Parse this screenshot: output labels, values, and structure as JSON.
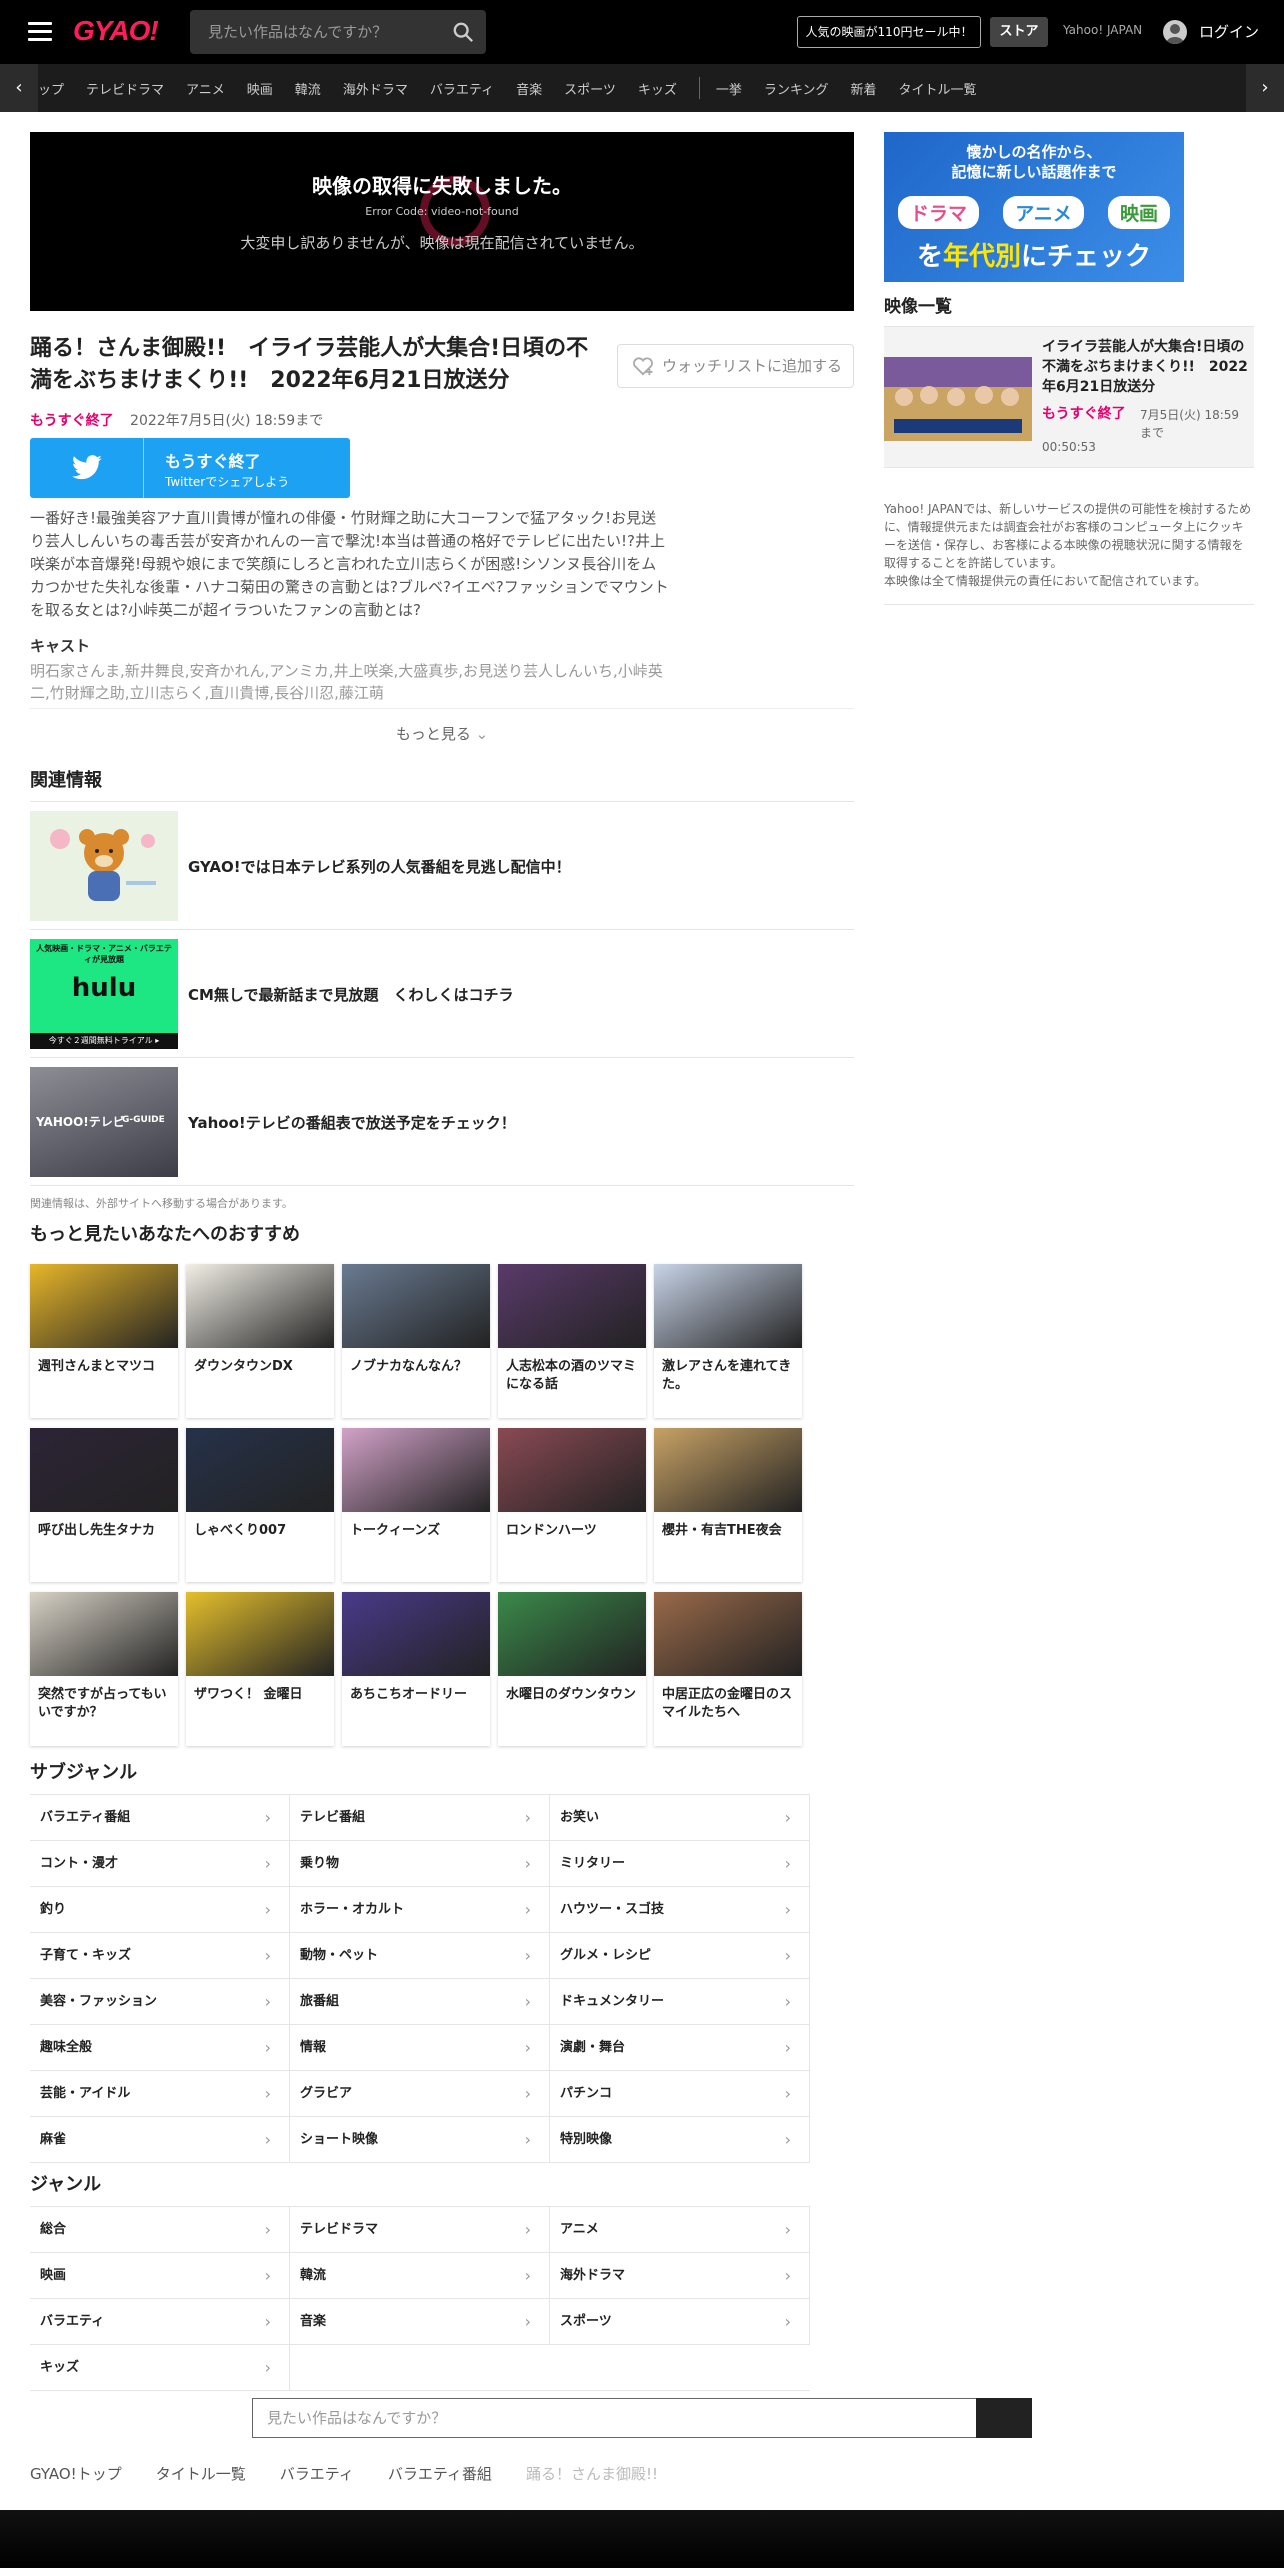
{
  "header": {
    "logo": "GYAO!",
    "search_placeholder": "見たい作品はなんですか？",
    "sale_banner": "人気の映画が110円セール中！",
    "store_button": "ストア",
    "yahoo_link": "Yahoo! JAPAN",
    "login": "ログイン"
  },
  "nav": {
    "items": [
      "ップ",
      "テレビドラマ",
      "アニメ",
      "映画",
      "韓流",
      "海外ドラマ",
      "バラエティ",
      "音楽",
      "スポーツ",
      "キッズ",
      "一挙",
      "ランキング",
      "新着",
      "タイトル一覧"
    ]
  },
  "player": {
    "error_title": "映像の取得に失敗しました。",
    "error_code": "Error Code: video-not-found",
    "error_message": "大変申し訳ありませんが、映像は現在配信されていません。"
  },
  "episode": {
    "title": "踊る！さんま御殿!!　イライラ芸能人が大集合!日頃の不満をぶちまけまくり!!　2022年6月21日放送分",
    "watchlist_button": "ウォッチリストに追加する",
    "ending_badge": "もうすぐ終了",
    "available_until": "2022年7月5日(火) 18:59まで",
    "twitter_line1": "もうすぐ終了",
    "twitter_line2": "Twitterでシェアしよう",
    "description": "一番好き!最強美容アナ直川貴博が憧れの俳優・竹財輝之助に大コーフンで猛アタック!お見送り芸人しんいちの毒舌芸が安斉かれんの一言で撃沈!本当は普通の格好でテレビに出たい!?井上咲楽が本音爆発!母親や娘にまで笑顔にしろと言われた立川志らくが困惑!シソンヌ長谷川をムカつかせた失礼な後輩・ハナコ菊田の驚きの言動とは?ブルベ?イエベ?ファッションでマウントを取る女とは?小峠英二が超イラついたファンの言動とは?",
    "cast_heading": "キャスト",
    "cast": "明石家さんま,新井舞良,安斉かれん,アンミカ,井上咲楽,大盛真歩,お見送り芸人しんいち,小峠英二,竹財輝之助,立川志らく,直川貴博,長谷川忍,藤江萌",
    "more_button": "もっと見る"
  },
  "related": {
    "heading": "関連情報",
    "items": [
      {
        "text": "GYAO!では日本テレビ系列の人気番組を見逃し配信中！"
      },
      {
        "text": "CM無しで最新話まで見放題　くわしくはコチラ",
        "thumb_top": "人気映画・ドラマ・アニメ・バラエティが見放題",
        "thumb_logo": "hulu",
        "thumb_bottom": "今すぐ２週間無料トライアル ▸"
      },
      {
        "text": "Yahoo!テレビの番組表で放送予定をチェック！",
        "thumb_logo": "YAHOO!テレビ",
        "thumb_sub": "G-GUIDE"
      }
    ],
    "note": "関連情報は、外部サイトへ移動する場合があります。"
  },
  "recommend": {
    "heading": "もっと見たいあなたへのおすすめ",
    "items": [
      {
        "title": "週刊さんまとマツコ",
        "color": "#e7b62a"
      },
      {
        "title": "ダウンタウンDX",
        "color": "#f2efe6"
      },
      {
        "title": "ノブナカなんなん？",
        "color": "#6a7b92"
      },
      {
        "title": "人志松本の酒のツマミになる話",
        "color": "#5a3a6a"
      },
      {
        "title": "激レアさんを連れてきた。",
        "color": "#c9d4e8"
      },
      {
        "title": "呼び出し先生タナカ",
        "color": "#2c2436"
      },
      {
        "title": "しゃべくり007",
        "color": "#26324a"
      },
      {
        "title": "トークィーンズ",
        "color": "#d2a2c8"
      },
      {
        "title": "ロンドンハーツ",
        "color": "#8a4a54"
      },
      {
        "title": "櫻井・有吉THE夜会",
        "color": "#c8a266"
      },
      {
        "title": "突然ですが占ってもいいですか？",
        "color": "#d8d2c6"
      },
      {
        "title": "ザワつく！ 金曜日",
        "color": "#e5c02c"
      },
      {
        "title": "あちこちオードリー",
        "color": "#4a3a8a"
      },
      {
        "title": "水曜日のダウンタウン",
        "color": "#3a8a4a"
      },
      {
        "title": "中居正広の金曜日のスマイルたちへ",
        "color": "#9a6a4a"
      }
    ]
  },
  "subgenre": {
    "heading": "サブジャンル",
    "items": [
      "バラエティ番組",
      "テレビ番組",
      "お笑い",
      "コント・漫才",
      "乗り物",
      "ミリタリー",
      "釣り",
      "ホラー・オカルト",
      "ハウツー・スゴ技",
      "子育て・キッズ",
      "動物・ペット",
      "グルメ・レシピ",
      "美容・ファッション",
      "旅番組",
      "ドキュメンタリー",
      "趣味全般",
      "情報",
      "演劇・舞台",
      "芸能・アイドル",
      "グラビア",
      "パチンコ",
      "麻雀",
      "ショート映像",
      "特別映像"
    ]
  },
  "genre": {
    "heading": "ジャンル",
    "items": [
      "総合",
      "テレビドラマ",
      "アニメ",
      "映画",
      "韓流",
      "海外ドラマ",
      "バラエティ",
      "音楽",
      "スポーツ",
      "キッズ"
    ]
  },
  "bottom_search": {
    "placeholder": "見たい作品はなんですか？"
  },
  "breadcrumbs": [
    "GYAO!トップ",
    "タイトル一覧",
    "バラエティ",
    "バラエティ番組",
    "踊る！さんま御殿!!"
  ],
  "sidebar": {
    "banner_line1": "懐かしの名作から、",
    "banner_line2": "記憶に新しい話題作まで",
    "banner_pills": [
      "ドラマ",
      "アニメ",
      "映画"
    ],
    "banner_line3a": "を",
    "banner_line3b": "年代別",
    "banner_line3c": "にチェック",
    "video_list_heading": "映像一覧",
    "video_title": "イライラ芸能人が大集合!日頃の不満をぶちまけまくり!!　2022年6月21日放送分",
    "video_ending": "もうすぐ終了",
    "video_until": "7月5日(火) 18:59まで",
    "video_duration": "00:50:53",
    "notice": "Yahoo! JAPANでは、新しいサービスの提供の可能性を検討するために、情報提供元または調査会社がお客様のコンピュータ上にクッキーを送信・保存し、お客様による本映像の視聴状況に関する情報を取得することを許諾しています。\n本映像は全て情報提供元の責任において配信されています。"
  },
  "colors": {
    "brand": "#ff1c5b",
    "accent": "#e6006e",
    "twitter": "#1da1f2"
  }
}
